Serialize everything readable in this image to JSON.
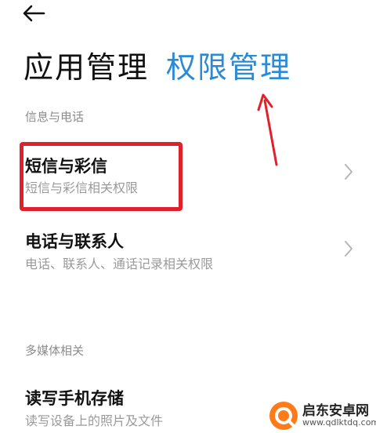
{
  "header": {
    "tab_app_management": "应用管理",
    "tab_permission_management": "权限管理"
  },
  "sections": [
    {
      "header": "信息与电话",
      "items": [
        {
          "title": "短信与彩信",
          "desc": "短信与彩信相关权限"
        },
        {
          "title": "电话与联系人",
          "desc": "电话、联系人、通话记录相关权限"
        }
      ]
    },
    {
      "header": "多媒体相关",
      "items": [
        {
          "title": "读写手机存储",
          "desc": "读写设备上的照片及文件"
        }
      ]
    }
  ],
  "watermark": {
    "name": "启东安卓网",
    "url": "www.qdlktdq.com"
  },
  "colors": {
    "accent": "#2b8ad6",
    "annotation": "#e0202a",
    "text_primary": "#111111",
    "text_secondary": "#9a9a9a"
  }
}
